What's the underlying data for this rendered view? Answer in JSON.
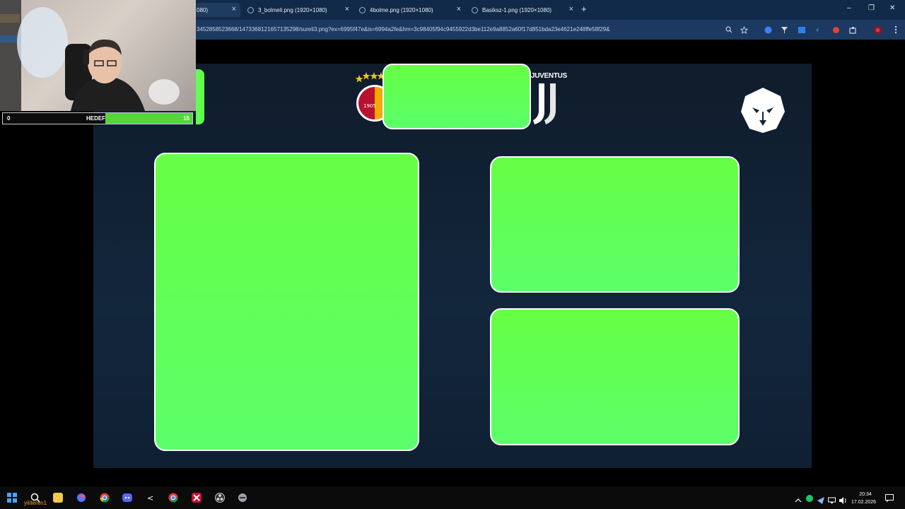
{
  "browser": {
    "tabs": [
      {
        "label": "080)",
        "active": true
      },
      {
        "label": "3_bolmeli.png (1920×1080)",
        "active": false
      },
      {
        "label": "4bolme.png (1920×1080)",
        "active": false
      },
      {
        "label": "Basiksz-1.png (1920×1080)",
        "active": false
      }
    ],
    "close_glyph": "×",
    "new_tab": "+",
    "address_url": "3452858523668/1473368121657135298/sureli3.png?ex=6995f47e&is=6994a2fe&hm=3c98405f94c9455922d3be112e9a8852a60f17d851bda23e4621e248ffe58f29&",
    "window_controls": {
      "minimize": "–",
      "restore": "❐",
      "close": "✕"
    }
  },
  "overlay": {
    "home_team_logo": "galatasaray-logo",
    "away_team_logo": "juventus-logo",
    "away_team_wordmark": "JUVENTUS",
    "brand_logo": "lion-head-logo",
    "green_color": "#66ff44",
    "background_color": "#12263c"
  },
  "stream": {
    "goal_bar": {
      "start": "0",
      "label": "HEDEF",
      "end": "15",
      "progress": 0.46
    }
  },
  "taskbar": {
    "user": "yiiiteren1",
    "time": "20:34",
    "date": "17.02.2026"
  },
  "colors": {
    "taskbar": "#0b0b0b",
    "browser_chrome": "#1c3a61",
    "accent_orange": "#f5a623"
  }
}
